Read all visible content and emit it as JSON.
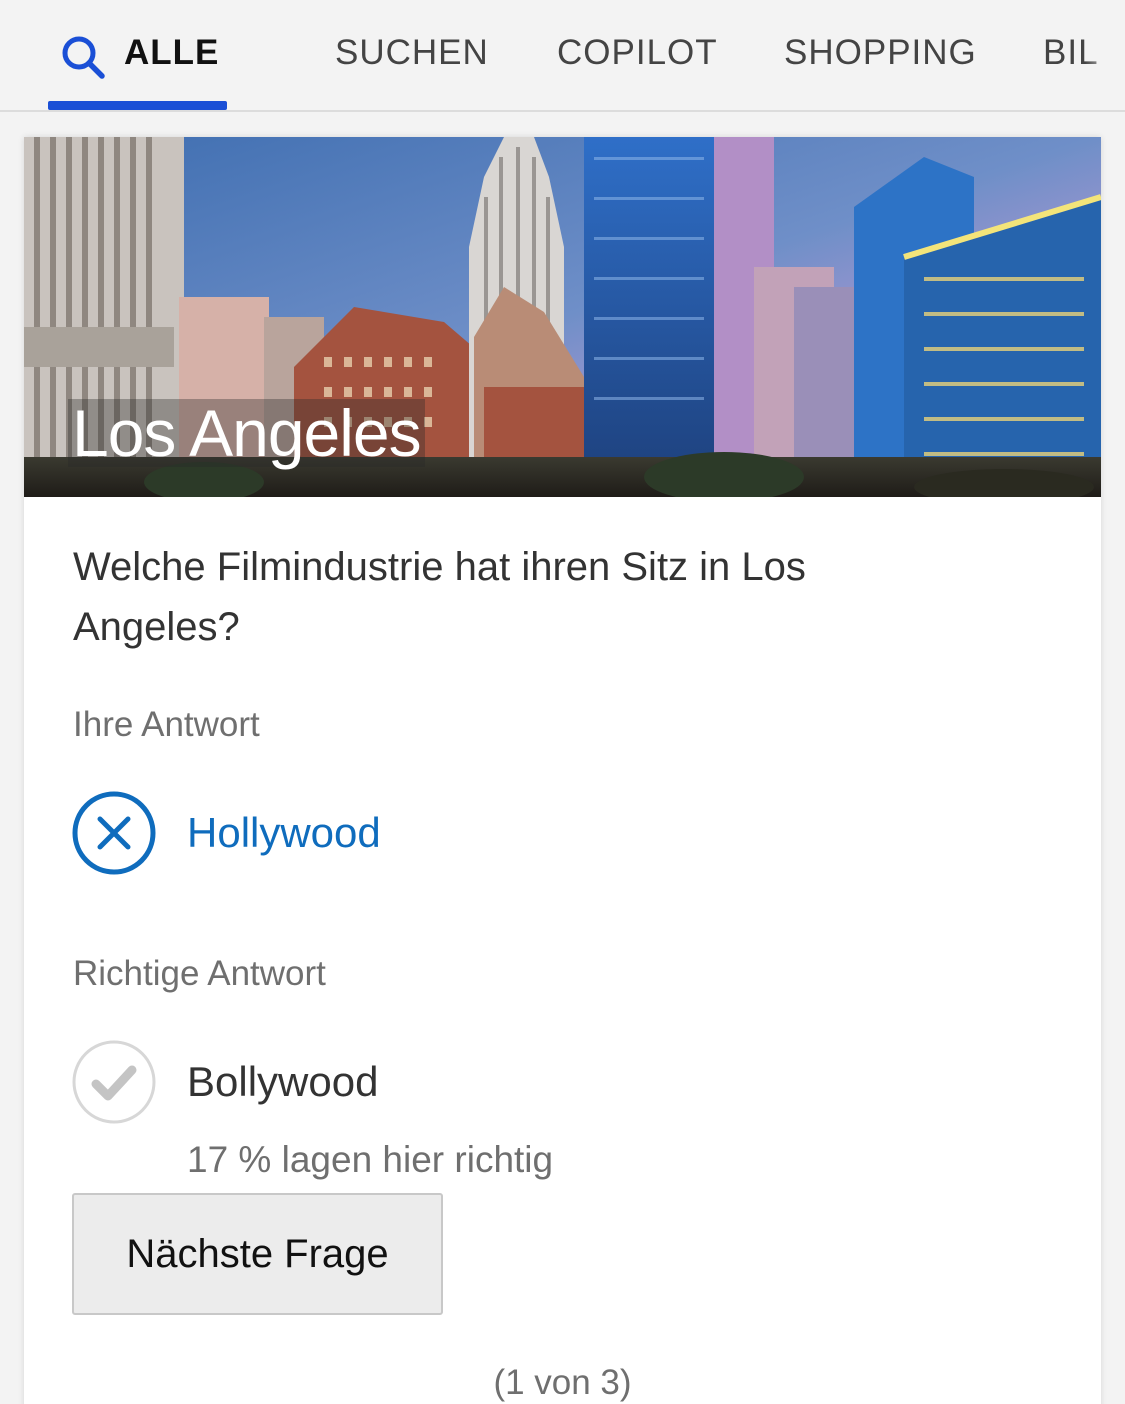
{
  "tabs": [
    {
      "label": "ALLE",
      "active": true
    },
    {
      "label": "SUCHEN",
      "active": false
    },
    {
      "label": "COPILOT",
      "active": false
    },
    {
      "label": "SHOPPING",
      "active": false
    },
    {
      "label": "BIL",
      "active": false
    }
  ],
  "colors": {
    "accent": "#1a4fd6",
    "link": "#0f6cbd",
    "muted": "#6f6f6f"
  },
  "quiz": {
    "hero_title": "Los Angeles",
    "question": "Welche Filmindustrie hat ihren Sitz in Los Angeles?",
    "your_answer_label": "Ihre Antwort",
    "your_answer": "Hollywood",
    "your_answer_icon": "wrong-circle-x-icon",
    "correct_answer_label": "Richtige Antwort",
    "correct_answer": "Bollywood",
    "correct_answer_icon": "check-circle-icon",
    "stat": "17 % lagen hier richtig",
    "next_button": "Nächste Frage",
    "pager": "(1 von 3)"
  }
}
